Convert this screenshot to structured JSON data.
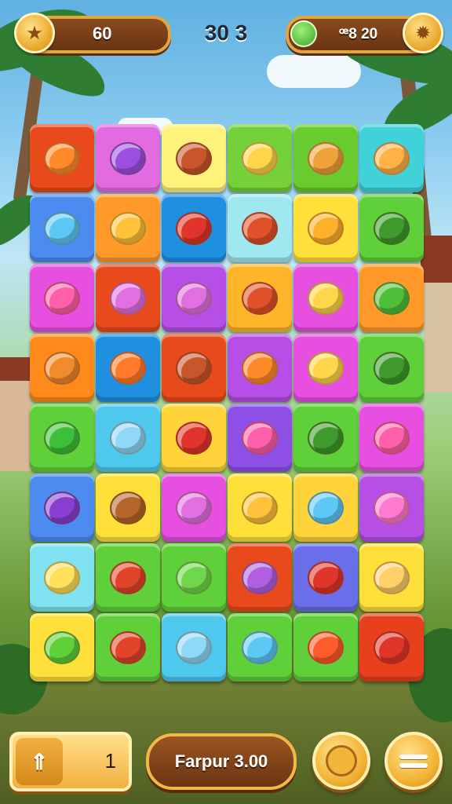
{
  "hud": {
    "left_value": "60",
    "left_icon": "star-icon",
    "score": "30 3",
    "right_value": "ꟹ8 20",
    "right_icon": "sun-icon"
  },
  "board": {
    "rows": [
      [
        {
          "bg": "#e84a1c",
          "gem": "#ff8a2a",
          "icon": "flower"
        },
        {
          "bg": "#e36be0",
          "gem": "#9b4fe0",
          "icon": "gear"
        },
        {
          "bg": "#fff27a",
          "gem": "#c9552a",
          "icon": "bug"
        },
        {
          "bg": "#74d13a",
          "gem": "#ffd54a",
          "icon": "pencil"
        },
        {
          "bg": "#6acb2e",
          "gem": "#f0a23a",
          "icon": "carrot"
        },
        {
          "bg": "#3fd2d8",
          "gem": "#ffb347",
          "icon": "flask"
        }
      ],
      [
        {
          "bg": "#4c8bf0",
          "gem": "#5dc8f5",
          "icon": "leaf"
        },
        {
          "bg": "#ff9a2a",
          "gem": "#ffc23a",
          "icon": "heart"
        },
        {
          "bg": "#1f8fe0",
          "gem": "#e0352a",
          "icon": "apple"
        },
        {
          "bg": "#9fe8f0",
          "gem": "#e0512a",
          "icon": "key"
        },
        {
          "bg": "#ffe03a",
          "gem": "#ffb02a",
          "icon": "orange"
        },
        {
          "bg": "#5fcf3a",
          "gem": "#3e9a2a",
          "icon": "nut"
        }
      ],
      [
        {
          "bg": "#e64fe0",
          "gem": "#ff5fa8",
          "icon": "strawberry"
        },
        {
          "bg": "#e84a1c",
          "gem": "#e070e0",
          "icon": "onion"
        },
        {
          "bg": "#b64fe6",
          "gem": "#e070e0",
          "icon": "shell"
        },
        {
          "bg": "#ffb52a",
          "gem": "#e0512a",
          "icon": "rocket"
        },
        {
          "bg": "#e64fe0",
          "gem": "#ffd54a",
          "icon": "bean"
        },
        {
          "bg": "#ff9a2a",
          "gem": "#4fbf3a",
          "icon": "lime"
        }
      ],
      [
        {
          "bg": "#ff8a1c",
          "gem": "#f08a2a",
          "icon": "donut"
        },
        {
          "bg": "#1f8fe0",
          "gem": "#ff7a2a",
          "icon": "drop"
        },
        {
          "bg": "#e84a1c",
          "gem": "#c9552a",
          "icon": "chest"
        },
        {
          "bg": "#b64fe6",
          "gem": "#ff8a2a",
          "icon": "cracker"
        },
        {
          "bg": "#e64fe0",
          "gem": "#ffd54a",
          "icon": "bean"
        },
        {
          "bg": "#5fcf3a",
          "gem": "#3e9a2a",
          "icon": "nut"
        }
      ],
      [
        {
          "bg": "#5fcf3a",
          "gem": "#3ebf3a",
          "icon": "cocoon"
        },
        {
          "bg": "#4fc8ee",
          "gem": "#8fd8f8",
          "icon": "bean"
        },
        {
          "bg": "#ffd43a",
          "gem": "#e0352a",
          "icon": "apple"
        },
        {
          "bg": "#8e4fe6",
          "gem": "#ff5fa8",
          "icon": "strawberry"
        },
        {
          "bg": "#5fcf3a",
          "gem": "#3e9a2a",
          "icon": "nut"
        },
        {
          "bg": "#e64fe0",
          "gem": "#ff5fa8",
          "icon": "strawberry"
        }
      ],
      [
        {
          "bg": "#4c8bf0",
          "gem": "#8a3ed0",
          "icon": "eggplant"
        },
        {
          "bg": "#ffe03a",
          "gem": "#b5642a",
          "icon": "pinecone"
        },
        {
          "bg": "#e64fe0",
          "gem": "#e070e0",
          "icon": "egg"
        },
        {
          "bg": "#ffe03a",
          "gem": "#ffc23a",
          "icon": "bean"
        },
        {
          "bg": "#ffd43a",
          "gem": "#5dc8f5",
          "icon": "leaf"
        },
        {
          "bg": "#b64fe6",
          "gem": "#ff7ad0",
          "icon": "monster"
        }
      ],
      [
        {
          "bg": "#7fe2f0",
          "gem": "#ffe05a",
          "icon": "leaf"
        },
        {
          "bg": "#5fcf3a",
          "gem": "#e0452a",
          "icon": "pepper"
        },
        {
          "bg": "#5fcf3a",
          "gem": "#6fd84a",
          "icon": "leaf"
        },
        {
          "bg": "#e84a1c",
          "gem": "#b05fe0",
          "icon": "cracker"
        },
        {
          "bg": "#6a6ee8",
          "gem": "#e0352a",
          "icon": "carrot"
        },
        {
          "bg": "#ffe03a",
          "gem": "#ffcf6a",
          "icon": "star"
        }
      ],
      [
        {
          "bg": "#ffe03a",
          "gem": "#5fcf3a",
          "icon": "cocoon"
        },
        {
          "bg": "#5fcf3a",
          "gem": "#e0452a",
          "icon": "twig"
        },
        {
          "bg": "#4fc8ee",
          "gem": "#8fd8f8",
          "icon": "lemon"
        },
        {
          "bg": "#5fcf3a",
          "gem": "#5dc8f5",
          "icon": "bean"
        },
        {
          "bg": "#5fcf3a",
          "gem": "#ff5a2a",
          "icon": "heart"
        },
        {
          "bg": "#e8401c",
          "gem": "#e0352a",
          "icon": "balloon"
        }
      ]
    ]
  },
  "bottom": {
    "left_icon": "map-icon",
    "left_value": "1",
    "center_label": "Farpur 3.00",
    "right1_icon": "lion-icon",
    "right2_icon": "menu-icon"
  }
}
